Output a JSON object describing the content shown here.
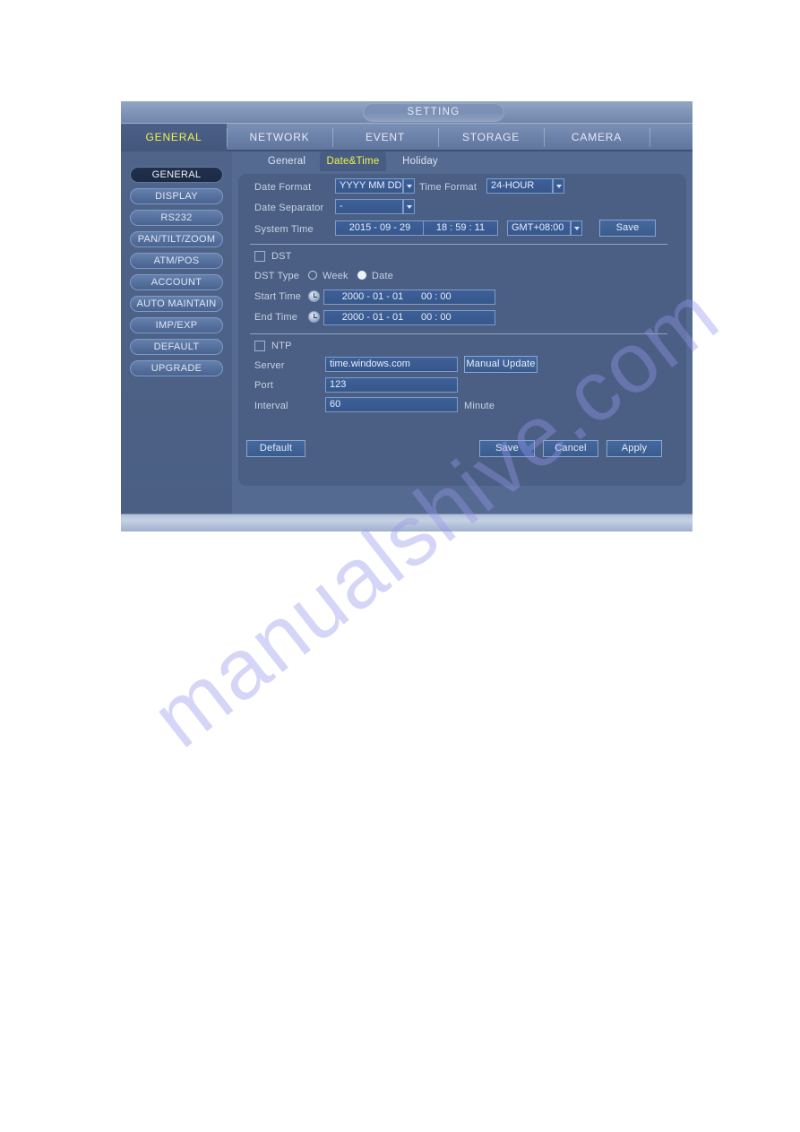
{
  "window": {
    "title": "SETTING"
  },
  "watermark": {
    "text": "manualshive.com"
  },
  "colors": {
    "accent_yellow": "#f2f24a",
    "window_bg": "#546a90",
    "panel_bg": "#4a5f83",
    "field_bg": "#3d6098",
    "field_border": "#7e9cc8",
    "active_sidebar": "#22304c"
  },
  "main_tabs": [
    {
      "label": "GENERAL",
      "active": true
    },
    {
      "label": "NETWORK",
      "active": false
    },
    {
      "label": "EVENT",
      "active": false
    },
    {
      "label": "STORAGE",
      "active": false
    },
    {
      "label": "CAMERA",
      "active": false
    }
  ],
  "sidebar": {
    "items": [
      {
        "label": "GENERAL",
        "active": true
      },
      {
        "label": "DISPLAY",
        "active": false
      },
      {
        "label": "RS232",
        "active": false
      },
      {
        "label": "PAN/TILT/ZOOM",
        "active": false
      },
      {
        "label": "ATM/POS",
        "active": false
      },
      {
        "label": "ACCOUNT",
        "active": false
      },
      {
        "label": "AUTO MAINTAIN",
        "active": false
      },
      {
        "label": "IMP/EXP",
        "active": false
      },
      {
        "label": "DEFAULT",
        "active": false
      },
      {
        "label": "UPGRADE",
        "active": false
      }
    ]
  },
  "sub_tabs": [
    {
      "label": "General",
      "active": false
    },
    {
      "label": "Date&Time",
      "active": true
    },
    {
      "label": "Holiday",
      "active": false
    }
  ],
  "datetime_section": {
    "date_format_label": "Date Format",
    "date_format_value": "YYYY MM DD",
    "time_format_label": "Time Format",
    "time_format_value": "24-HOUR",
    "date_separator_label": "Date Separator",
    "date_separator_value": "-",
    "system_time_label": "System Time",
    "system_time_date": "2015 - 09 - 29",
    "system_time_clock": "18 : 59 : 11",
    "timezone_value": "GMT+08:00",
    "save_label": "Save"
  },
  "dst_section": {
    "checkbox_label": "DST",
    "checked": false,
    "type_label": "DST Type",
    "type_options": [
      {
        "label": "Week",
        "selected": false
      },
      {
        "label": "Date",
        "selected": true
      }
    ],
    "start_time_label": "Start Time",
    "start_time_date": "2000 - 01 - 01",
    "start_time_clock": "00 : 00",
    "end_time_label": "End Time",
    "end_time_date": "2000 - 01 - 01",
    "end_time_clock": "00 : 00"
  },
  "ntp_section": {
    "checkbox_label": "NTP",
    "checked": false,
    "server_label": "Server",
    "server_value": "time.windows.com",
    "manual_update_label": "Manual Update",
    "port_label": "Port",
    "port_value": "123",
    "interval_label": "Interval",
    "interval_value": "60",
    "interval_unit": "Minute"
  },
  "footer_buttons": {
    "default_label": "Default",
    "save_label": "Save",
    "cancel_label": "Cancel",
    "apply_label": "Apply"
  }
}
